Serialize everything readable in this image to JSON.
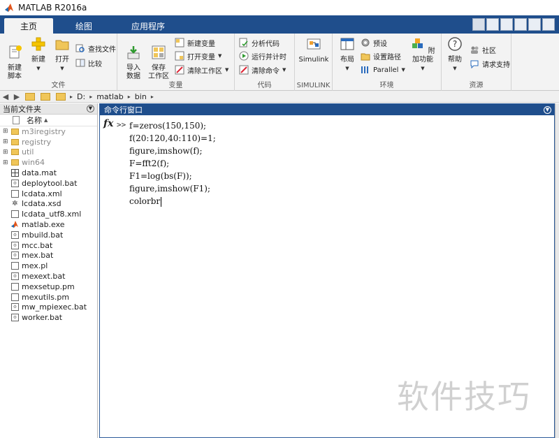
{
  "window": {
    "title": "MATLAB R2016a"
  },
  "tabs": [
    {
      "label": "主页",
      "active": true
    },
    {
      "label": "绘图",
      "active": false
    },
    {
      "label": "应用程序",
      "active": false
    }
  ],
  "ribbon": {
    "file": {
      "label": "文件",
      "new_script": "新建\n脚本",
      "new": "新建",
      "open": "打开",
      "find_files": "查找文件",
      "compare": "比较"
    },
    "variable": {
      "label": "变量",
      "import": "导入\n数据",
      "save_ws": "保存\n工作区",
      "new_var": "新建变量",
      "open_var": "打开变量",
      "clear_ws": "清除工作区"
    },
    "code": {
      "label": "代码",
      "analyze": "分析代码",
      "run_time": "运行并计时",
      "clear_cmd": "清除命令"
    },
    "simulink": {
      "label": "SIMULINK",
      "simulink": "Simulink"
    },
    "env": {
      "label": "环境",
      "layout": "布局",
      "prefs": "预设",
      "set_path": "设置路径",
      "parallel": "Parallel",
      "addons": "附加功能"
    },
    "resources": {
      "label": "资源",
      "help": "帮助",
      "community": "社区",
      "support": "请求支持"
    }
  },
  "address": {
    "crumbs": [
      "D:",
      "matlab",
      "bin"
    ]
  },
  "current_folder": {
    "title": "当前文件夹",
    "column": "名称",
    "sort_arrow": "▲",
    "items": [
      {
        "name": "m3iregistry",
        "type": "folder",
        "exp": "⊞"
      },
      {
        "name": "registry",
        "type": "folder",
        "exp": "⊞"
      },
      {
        "name": "util",
        "type": "folder",
        "exp": "⊞"
      },
      {
        "name": "win64",
        "type": "folder",
        "exp": "⊞"
      },
      {
        "name": "data.mat",
        "type": "mat",
        "exp": ""
      },
      {
        "name": "deploytool.bat",
        "type": "bat",
        "exp": ""
      },
      {
        "name": "lcdata.xml",
        "type": "doc",
        "exp": ""
      },
      {
        "name": "lcdata.xsd",
        "type": "xsd",
        "exp": ""
      },
      {
        "name": "lcdata_utf8.xml",
        "type": "doc",
        "exp": ""
      },
      {
        "name": "matlab.exe",
        "type": "exe",
        "exp": ""
      },
      {
        "name": "mbuild.bat",
        "type": "bat",
        "exp": ""
      },
      {
        "name": "mcc.bat",
        "type": "bat",
        "exp": ""
      },
      {
        "name": "mex.bat",
        "type": "bat",
        "exp": ""
      },
      {
        "name": "mex.pl",
        "type": "doc",
        "exp": ""
      },
      {
        "name": "mexext.bat",
        "type": "bat",
        "exp": ""
      },
      {
        "name": "mexsetup.pm",
        "type": "doc",
        "exp": ""
      },
      {
        "name": "mexutils.pm",
        "type": "doc",
        "exp": ""
      },
      {
        "name": "mw_mpiexec.bat",
        "type": "bat",
        "exp": ""
      },
      {
        "name": "worker.bat",
        "type": "bat",
        "exp": ""
      }
    ]
  },
  "command_window": {
    "title": "命令行窗口",
    "fx": "fx",
    "prompt": ">>",
    "lines": [
      "f=zeros(150,150);",
      "f(20:120,40:110)=1;",
      "figure,imshow(f);",
      "F=fft2(f);",
      "F1=log(bs(F));",
      "figure,imshow(F1);",
      "colorbr"
    ]
  },
  "watermark": "软件技巧",
  "icons": {
    "back": "◀",
    "forward": "▶",
    "dropdown": "▼",
    "chevron": "▸"
  }
}
